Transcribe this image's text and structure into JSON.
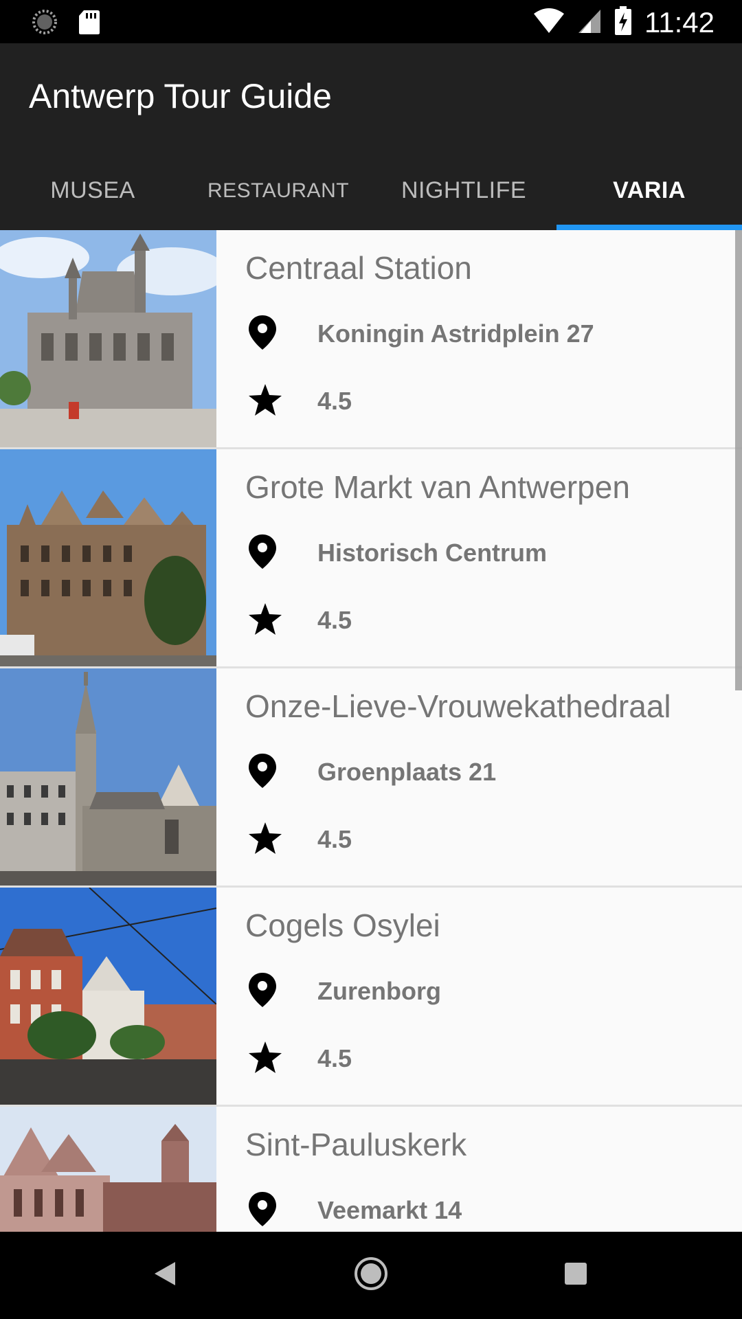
{
  "status_bar": {
    "time": "11:42"
  },
  "app": {
    "title": "Antwerp Tour Guide"
  },
  "tabs": [
    {
      "label": "MUSEA",
      "active": false
    },
    {
      "label": "RESTAURANT",
      "active": false
    },
    {
      "label": "NIGHTLIFE",
      "active": false
    },
    {
      "label": "VARIA",
      "active": true
    }
  ],
  "colors": {
    "app_bar": "#212121",
    "tab_indicator": "#2196f3",
    "list_background": "#fafafa",
    "text_secondary": "#757575"
  },
  "places": [
    {
      "name": "Centraal Station",
      "address": "Koningin Astridplein 27",
      "rating": "4.5"
    },
    {
      "name": "Grote Markt van Antwerpen",
      "address": "Historisch Centrum",
      "rating": "4.5"
    },
    {
      "name": "Onze-Lieve-Vrouwekathedraal",
      "address": "Groenplaats 21",
      "rating": "4.5"
    },
    {
      "name": "Cogels Osylei",
      "address": "Zurenborg",
      "rating": "4.5"
    },
    {
      "name": "Sint-Pauluskerk",
      "address": "Veemarkt 14",
      "rating": ""
    }
  ],
  "icons": {
    "location": "location-pin-icon",
    "rating": "star-icon"
  }
}
